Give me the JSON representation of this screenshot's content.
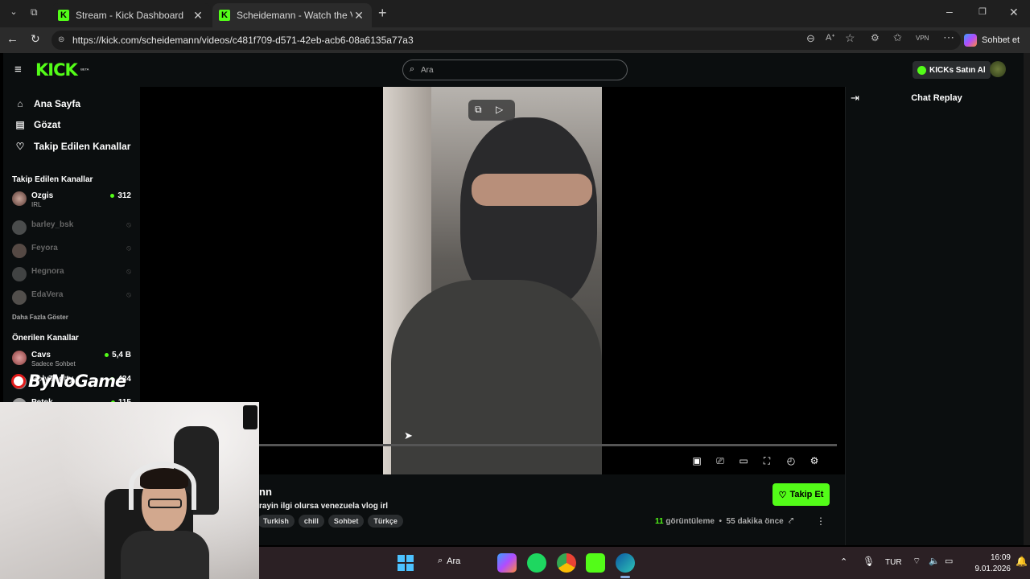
{
  "browser": {
    "tabs": [
      {
        "title": "Stream - Kick Dashboard",
        "active": false
      },
      {
        "title": "Scheidemann - Watch the VOD on",
        "active": true
      }
    ],
    "url": "https://kick.com/scheidemann/videos/c481f709-d571-42eb-acb6-08a6135a77a3",
    "copilot_label": "Sohbet et"
  },
  "kick": {
    "logo": "KICK",
    "logo_badge": "BETA",
    "search_placeholder": "Ara",
    "buy_kicks": "KICKs Satın Al",
    "nav": [
      {
        "label": "Ana Sayfa",
        "icon": "home-icon"
      },
      {
        "label": "Gözat",
        "icon": "browse-icon"
      },
      {
        "label": "Takip Edilen Kanallar",
        "icon": "heart-icon"
      }
    ],
    "followed_header": "Takip Edilen Kanallar",
    "followed": [
      {
        "name": "Ozgis",
        "sub": "IRL",
        "count": "312",
        "live": true
      },
      {
        "name": "barley_bsk",
        "live": false
      },
      {
        "name": "Feyora",
        "live": false
      },
      {
        "name": "Hegnora",
        "live": false
      },
      {
        "name": "EdaVera",
        "live": false
      }
    ],
    "show_more": "Daha Fazla Göster",
    "recommended_header": "Önerilen Kanallar",
    "recommended": [
      {
        "name": "Cavs",
        "sub": "Sadece Sohbet",
        "count": "5,4 B"
      },
      {
        "name": "HolyThotty",
        "count": "434"
      },
      {
        "name": "Petek",
        "count": "115"
      }
    ],
    "chat_title": "Chat Replay",
    "channel_name_partial": "nn",
    "stream_title_partial": "rayin ilgi olursa venezuela vlog irl",
    "tags": [
      "Turkish",
      "chill",
      "Sohbet",
      "Türkçe"
    ],
    "follow_button": "Takip Et",
    "views_count": "11",
    "views_label": "görüntüleme",
    "time_ago": "55 dakika önce"
  },
  "watermark": "ByNoGame",
  "taskbar": {
    "search": "Ara",
    "lang": "TUR",
    "time": "16:09",
    "date": "9.01.2026"
  },
  "colors": {
    "kick_green": "#53fc18",
    "bg": "#0b0e0f"
  }
}
